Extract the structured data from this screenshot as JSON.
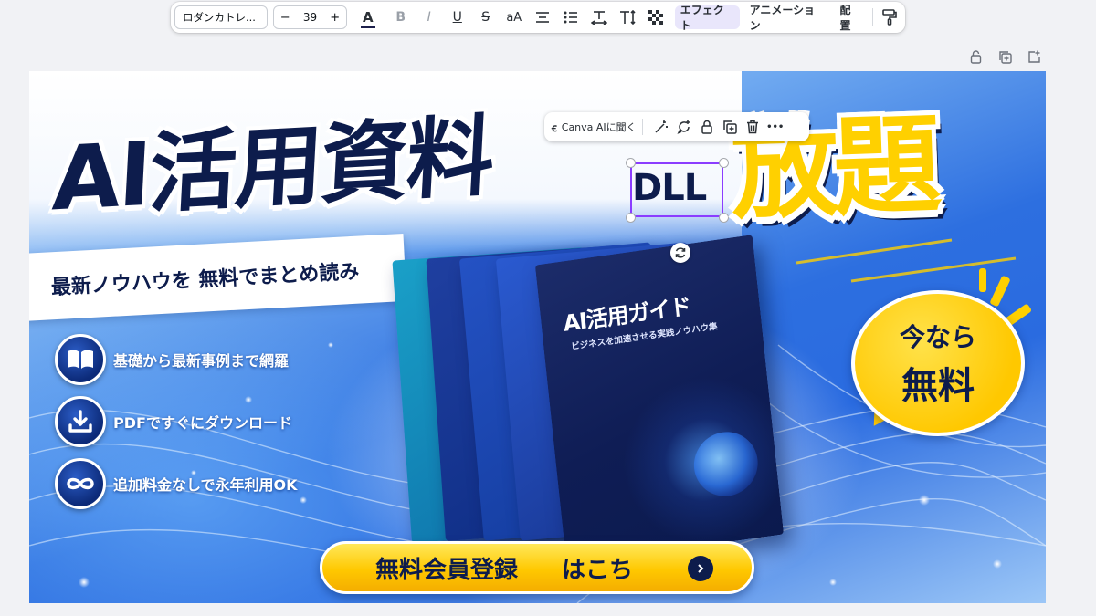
{
  "toolbar": {
    "font_name": "ロダンカトレ...",
    "font_size": "39",
    "decrease_label": "−",
    "increase_label": "+",
    "text_color_label": "A",
    "bold_label": "B",
    "italic_label": "I",
    "underline_label": "U",
    "strikethrough_label": "S",
    "case_label": "aA",
    "effects_label": "エフェクト",
    "animation_label": "アニメーション",
    "position_label": "配置",
    "text_color_underline": "#1c1f4a"
  },
  "element_toolbar": {
    "ask_ai_label": "Canva AIに聞く",
    "more_label": "•••"
  },
  "design": {
    "headline": "AI活用資料",
    "dll": "DLL",
    "houdai": "放題",
    "subtitle": "最新ノウハウを 無料でまとめ読み",
    "features": [
      {
        "icon": "book-icon",
        "label": "基礎から最新事例まで網羅"
      },
      {
        "icon": "download-icon",
        "label": "PDFですぐにダウンロード"
      },
      {
        "icon": "infinity-icon",
        "label": "追加料金なしで永年利用OK"
      }
    ],
    "book_title": "AI活用ガイド",
    "book_subtitle": "ビジネスを加速させる実践ノウハウ集",
    "bubble_line1": "今なら",
    "bubble_line2": "無料",
    "cta_main": "無料会員登録",
    "cta_sub": "はこち",
    "colors": {
      "navy": "#0d1c4c",
      "yellow": "#ffd000",
      "selection": "#8b3dff",
      "active_tab": "#e9e6fb"
    }
  }
}
